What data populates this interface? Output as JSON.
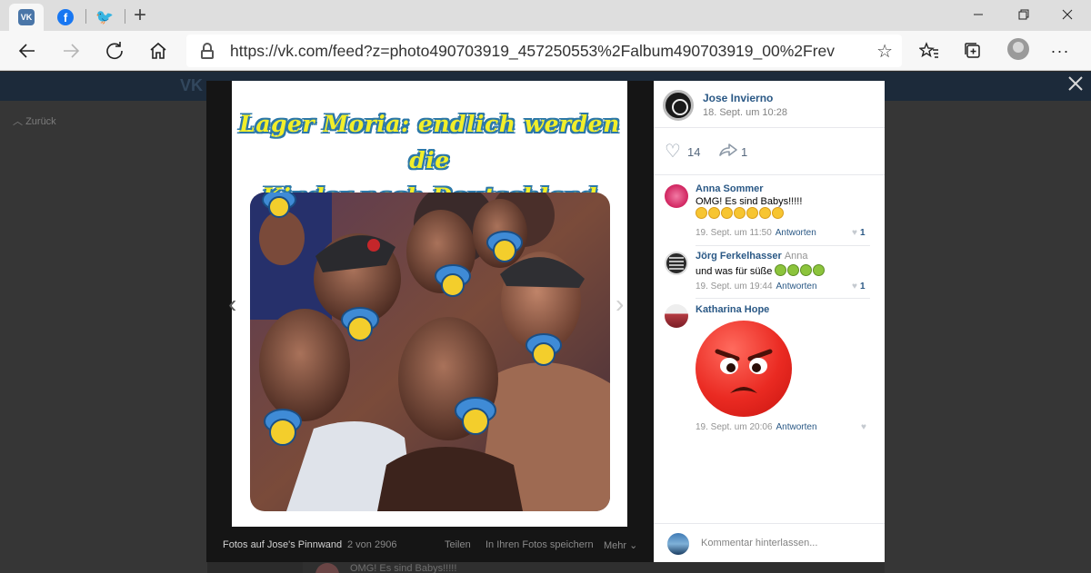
{
  "browser": {
    "tabs": [
      {
        "name": "vk",
        "icon": "vk-icon",
        "label": "VK"
      },
      {
        "name": "facebook",
        "icon": "facebook-icon",
        "label": "f"
      },
      {
        "name": "twitter",
        "icon": "twitter-icon",
        "label": "🐦"
      }
    ],
    "new_tab_label": "+",
    "url": "https://vk.com/feed?z=photo490703919_457250553%2Falbum490703919_00%2Frev"
  },
  "vk_page": {
    "back_label": "Zurück",
    "behind_comment_text": "OMG! Es sind Babys!!!!!"
  },
  "photo": {
    "title_line1": "Lager Moria: endlich werden die",
    "title_line2": "Kinder nach Deutschland gebracht",
    "footer": {
      "album_label": "Fotos auf Jose's Pinnwand",
      "counter": "2 von 2906",
      "share_label": "Teilen",
      "save_label": "In Ihren Fotos speichern",
      "more_label": "Mehr ⌄"
    }
  },
  "post": {
    "author": "Jose Invierno",
    "date": "18. Sept. um 10:28",
    "likes": "14",
    "shares": "1"
  },
  "comments": [
    {
      "author": "Anna Sommer",
      "reply_to": "",
      "text": "OMG! Es sind Babys!!!!!",
      "date": "19. Sept. um 11:50",
      "reply_label": "Antworten",
      "likes": "1",
      "avatar_color": "#e0457b"
    },
    {
      "author": "Jörg Ferkelhasser",
      "reply_to": "Anna",
      "text": "und was für süße",
      "date": "19. Sept. um 19:44",
      "reply_label": "Antworten",
      "likes": "1",
      "avatar_color": "#2a2a2a"
    },
    {
      "author": "Katharina Hope",
      "reply_to": "",
      "text": "",
      "date": "19. Sept. um 20:06",
      "reply_label": "Antworten",
      "likes": "",
      "avatar_color": "#b63c43"
    }
  ],
  "comment_input": {
    "placeholder": "Kommentar hinterlassen..."
  },
  "colors": {
    "vk_blue": "#2a5885",
    "vk_header": "#1c2a3a",
    "meme_yellow": "#f1ee2a",
    "meme_outline": "#2c78a8"
  }
}
